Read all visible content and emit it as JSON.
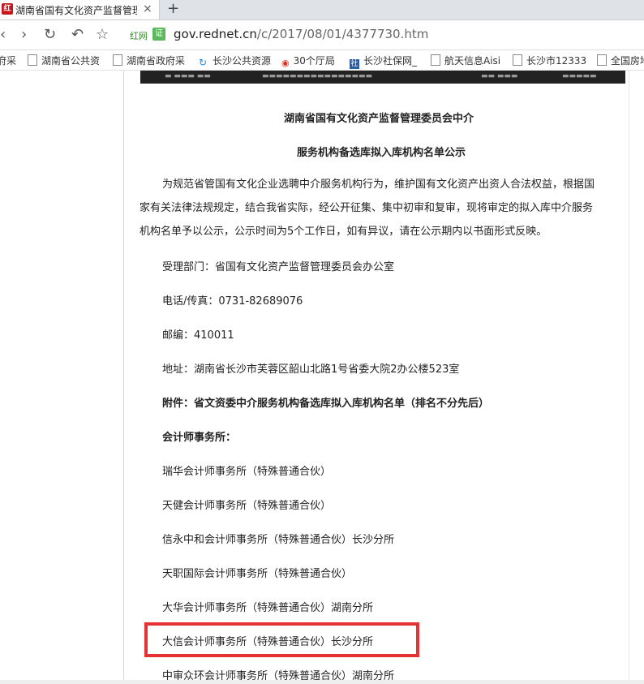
{
  "browser": {
    "tab_title": "湖南省国有文化资产监督管理",
    "tab_icon_text": "红",
    "new_tab": "+",
    "close": "×",
    "nav": {
      "back": "‹",
      "forward": "›",
      "reload": "↻",
      "undo": "↶",
      "star": "☆"
    },
    "site_badge": "红网",
    "secure_badge": "证",
    "url_domain": "gov.rednet.cn",
    "url_path": "/c/2017/08/01/4377730.htm"
  },
  "bookmarks": [
    {
      "label": "府采",
      "icon": "page-icon"
    },
    {
      "label": "湖南省公共资",
      "icon": "page-icon"
    },
    {
      "label": "湖南省政府采",
      "icon": "page-icon"
    },
    {
      "label": "长沙公共资源",
      "icon": "refresh-icon"
    },
    {
      "label": "30个厅局",
      "icon": "weibo-icon"
    },
    {
      "label": "长沙社保网_",
      "icon": "shebao-icon"
    },
    {
      "label": "航天信息Aisi",
      "icon": "page-icon"
    },
    {
      "label": "长沙市12333",
      "icon": "page-icon"
    },
    {
      "label": "全国房地",
      "icon": "page-icon"
    }
  ],
  "article": {
    "title1": "湖南省国有文化资产监督管理委员会中介",
    "title2": "服务机构备选库拟入库机构名单公示",
    "intro": "为规范省管国有文化企业选聘中介服务机构行为，维护国有文化资产出资人合法权益，根据国家有关法律法规规定，结合我省实际，经公开征集、集中初审和复审，现将审定的拟入库中介服务机构名单予以公示，公示时间为5个工作日，如有异议，请在公示期内以书面形式反映。",
    "dept": "受理部门：省国有文化资产监督管理委员会办公室",
    "phone": "电话/传真：0731-82689076",
    "postcode": "邮编：410011",
    "address": "地址：湖南省长沙市芙蓉区韶山北路1号省委大院2办公楼523室",
    "attachment": "附件：省文资委中介服务机构备选库拟入库机构名单（排名不分先后）",
    "section_heading": "会计师事务所：",
    "firms": [
      "瑞华会计师事务所（特殊普通合伙）",
      "天健会计师事务所（特殊普通合伙）",
      "信永中和会计师事务所（特殊普通合伙）长沙分所",
      "天职国际会计师事务所（特殊普通合伙）",
      "大华会计师事务所（特殊普通合伙）湖南分所",
      "大信会计师事务所（特殊普通合伙）长沙分所",
      "中审众环会计师事务所（特殊普通合伙）湖南分所"
    ]
  },
  "colors": {
    "highlight": "#e53333",
    "accent": "#c8161d"
  }
}
